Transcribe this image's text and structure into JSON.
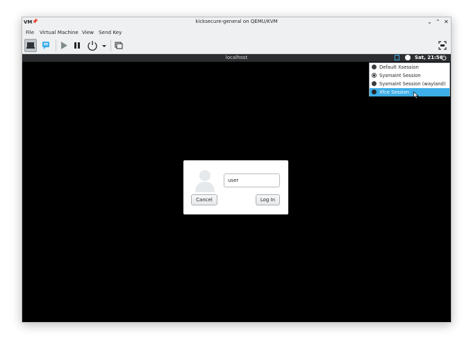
{
  "window": {
    "title": "kicksecure-general on QEMU/KVM",
    "app_logo": "VM",
    "buttons": {
      "minimize": "⌄",
      "maximize": "⌃",
      "close": "✕"
    }
  },
  "menubar": {
    "items": [
      "File",
      "Virtual Machine",
      "View",
      "Send Key"
    ]
  },
  "toolbar": {
    "icons": [
      "console-icon",
      "details-icon",
      "run-icon",
      "pause-icon",
      "power-icon",
      "dropdown-arrow-icon",
      "snapshots-icon",
      "fullscreen-icon"
    ],
    "active": "console-icon"
  },
  "guest": {
    "panel": {
      "hostname": "localhost",
      "clock": "Sat, 21:56"
    },
    "session_menu": {
      "items": [
        {
          "label": "Default Xsession",
          "state": "normal"
        },
        {
          "label": "Sysmaint Session",
          "state": "checked"
        },
        {
          "label": "Sysmaint Session (wayland)",
          "state": "normal"
        },
        {
          "label": "Xfce Session",
          "state": "selected"
        }
      ]
    },
    "login": {
      "username_value": "user",
      "cancel_label": "Cancel",
      "login_label": "Log In"
    }
  },
  "colors": {
    "accent": "#3daee9",
    "window_bg": "#eff0f1",
    "guest_bg": "#000000",
    "panel_bg": "#2b2d30"
  }
}
